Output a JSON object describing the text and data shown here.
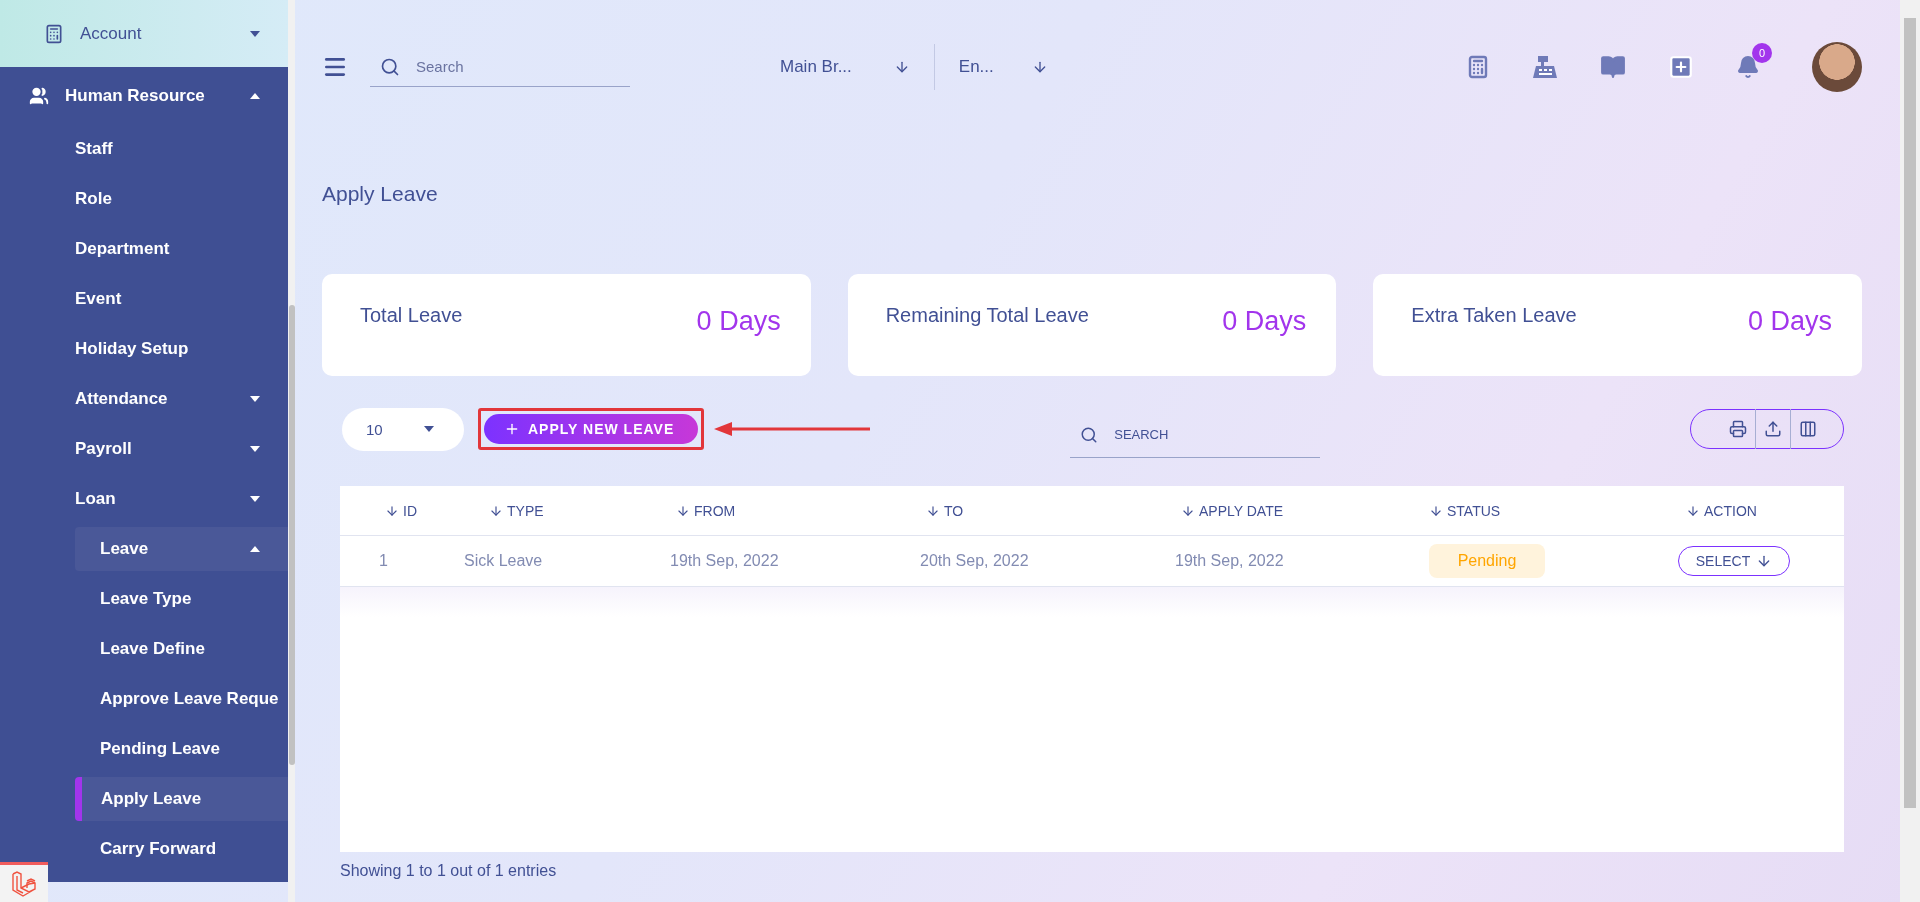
{
  "sidebar": {
    "items": [
      {
        "label": "Account",
        "expanded": false
      },
      {
        "label": "Human Resource",
        "expanded": true,
        "children": [
          {
            "label": "Staff",
            "selected": false
          },
          {
            "label": "Role",
            "selected": false
          },
          {
            "label": "Department",
            "selected": false
          },
          {
            "label": "Event",
            "selected": false
          },
          {
            "label": "Holiday Setup",
            "selected": false
          },
          {
            "label": "Attendance",
            "expanded": false,
            "selected": false
          },
          {
            "label": "Payroll",
            "expanded": false,
            "selected": false
          },
          {
            "label": "Loan",
            "expanded": false,
            "selected": false
          },
          {
            "label": "Leave",
            "expanded": true,
            "selected": false,
            "children": [
              {
                "label": "Leave Type",
                "selected": false
              },
              {
                "label": "Leave Define",
                "selected": false
              },
              {
                "label": "Approve Leave Reque",
                "selected": false
              },
              {
                "label": "Pending Leave",
                "selected": false
              },
              {
                "label": "Apply Leave",
                "selected": true
              },
              {
                "label": "Carry Forward",
                "selected": false
              }
            ]
          }
        ]
      }
    ]
  },
  "topbar": {
    "search": {
      "placeholder": "Search"
    },
    "branch": "Main Br...",
    "language": "En...",
    "notifications": "0"
  },
  "page_title": "Apply Leave",
  "cards": [
    {
      "label": "Total Leave",
      "value": "0 Days"
    },
    {
      "label": "Remaining Total Leave",
      "value": "0 Days"
    },
    {
      "label": "Extra Taken Leave",
      "value": "0 Days"
    }
  ],
  "toolbar": {
    "page_size": "10",
    "apply_button": "APPLY NEW LEAVE",
    "search": {
      "placeholder": "SEARCH"
    }
  },
  "table": {
    "columns": [
      "ID",
      "TYPE",
      "FROM",
      "TO",
      "APPLY DATE",
      "STATUS",
      "ACTION"
    ],
    "rows": [
      {
        "id": "1",
        "type": "Sick Leave",
        "from": "19th Sep, 2022",
        "to": "20th Sep, 2022",
        "apply_date": "19th Sep, 2022",
        "status": {
          "text": "Pending",
          "kind": "pending"
        },
        "action": "SELECT"
      }
    ]
  },
  "footer": "Showing 1 to 1 out of 1 entries"
}
